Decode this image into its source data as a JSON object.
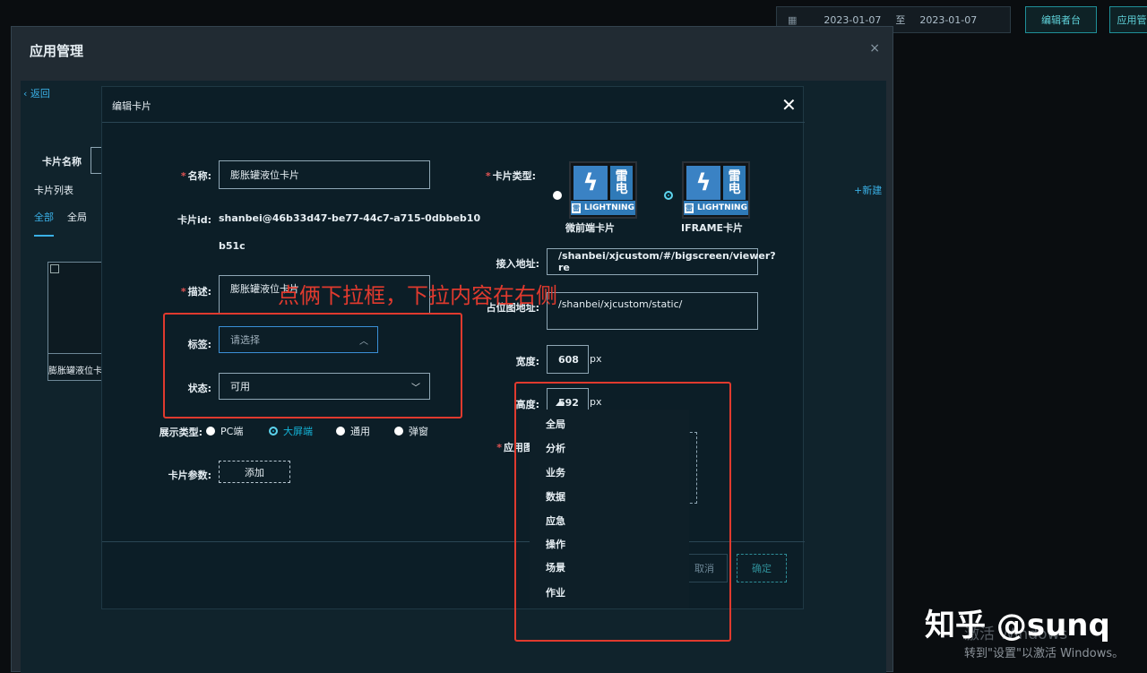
{
  "topbar": {
    "date_start": "2023-01-07",
    "date_sep": "至",
    "date_end": "2023-01-07",
    "btn_edit": "编辑者台",
    "btn_app": "应用管"
  },
  "outer": {
    "title": "应用管理",
    "close": "×",
    "back": "‹ 返回",
    "card_name_label": "卡片名称",
    "card_list_label": "卡片列表",
    "tab_all": "全部",
    "tab_global": "全局",
    "thumb_caption": "膨胀罐液位卡",
    "new_link": "+新建"
  },
  "modal": {
    "title": "编辑卡片",
    "close": "✕",
    "name_label": "名称:",
    "name_value": "膨胀罐液位卡片",
    "id_label": "卡片id:",
    "id_line1": "shanbei@46b33d47-be77-44c7-a715-0dbbeb10",
    "id_line2": "b51c",
    "desc_label": "描述:",
    "desc_value": "膨胀罐液位卡片",
    "tag_label": "标签:",
    "tag_placeholder": "请选择",
    "status_label": "状态:",
    "status_value": "可用",
    "display_type_label": "展示类型:",
    "display_types": [
      "PC端",
      "大屏端",
      "通用",
      "弹窗"
    ],
    "display_selected": "大屏端",
    "params_label": "卡片参数:",
    "params_button": "添加",
    "card_type_label": "卡片类型:",
    "card_types": [
      "微前端卡片",
      "IFRAME卡片"
    ],
    "card_type_selected": "IFRAME卡片",
    "access_label": "接入地址:",
    "access_value": "/shanbei/xjcustom/#/bigscreen/viewer?re",
    "placeholder_label": "占位图地址:",
    "placeholder_value": "/shanbei/xjcustom/static/",
    "width_label": "宽度:",
    "width_value": "608",
    "height_label": "高度:",
    "height_value": "592",
    "unit": "px",
    "app_icon_label": "应用图标",
    "cancel": "取消",
    "ok": "确定"
  },
  "icon_text": {
    "dian": "雷\n电",
    "lightning": "LIGHTNING",
    "small_badge": "雷"
  },
  "dropdown": {
    "items": [
      "全局",
      "分析",
      "业务",
      "数据",
      "应急",
      "操作",
      "场景",
      "作业"
    ]
  },
  "annotation": {
    "text": "点俩下拉框，下拉内容在右侧"
  },
  "watermark": {
    "zhihu": "知乎 @sunq",
    "win1": "激活 Windows",
    "win2": "转到\"设置\"以激活 Windows。"
  },
  "colors": {
    "accent": "#14b4d8",
    "annotation": "#e03a2e",
    "required": "#e05353"
  }
}
